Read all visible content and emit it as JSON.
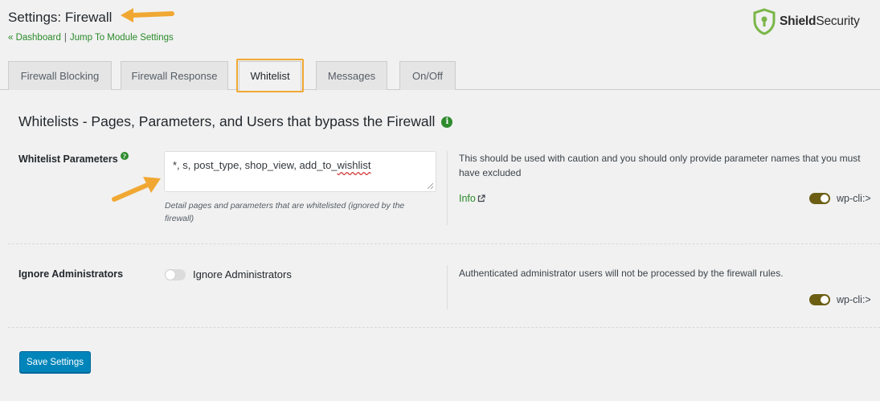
{
  "page": {
    "title": "Settings: Firewall"
  },
  "breadcrumbs": {
    "dashboard": "« Dashboard",
    "separator": "|",
    "jump": "Jump To Module Settings"
  },
  "logo": {
    "bold": "Shield",
    "regular": "Security",
    "icon": "shield-lock-icon",
    "color": "#7ab648"
  },
  "tabs": [
    {
      "label": "Firewall Blocking"
    },
    {
      "label": "Firewall Response"
    },
    {
      "label": "Whitelist",
      "active": true
    },
    {
      "label": "Messages"
    },
    {
      "label": "On/Off"
    }
  ],
  "section": {
    "title": "Whitelists - Pages, Parameters, and Users that bypass the Firewall",
    "info_icon": "info-icon"
  },
  "whitelist_params": {
    "label": "Whitelist Parameters",
    "value_prefix": "*, s, post_type, shop_view, add_to_",
    "value_misspelled": "wishlist",
    "help": "Detail pages and parameters that are whitelisted (ignored by the firewall)",
    "description": "This should be used with caution and you should only provide parameter names that you must have excluded",
    "info_link": "Info",
    "wpcli": "wp-cli:>",
    "wpcli_enabled": true
  },
  "ignore_admins": {
    "label": "Ignore Administrators",
    "toggle_label": "Ignore Administrators",
    "enabled": false,
    "description": "Authenticated administrator users will not be processed by the firewall rules.",
    "wpcli": "wp-cli:>",
    "wpcli_enabled": true
  },
  "save_button": "Save Settings",
  "colors": {
    "accent_green": "#2a8a2a",
    "annotation_orange": "#f0a833",
    "primary_button": "#0085ba",
    "toggle_on": "#6b5d12"
  }
}
